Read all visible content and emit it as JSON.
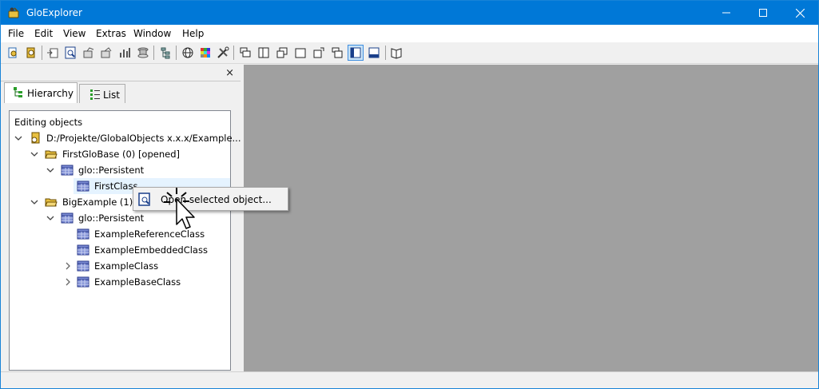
{
  "window": {
    "title": "GloExplorer"
  },
  "menu": [
    "File",
    "Edit",
    "View",
    "Extras",
    "Window",
    "Help"
  ],
  "toolbar": {
    "icons": [
      "open-db-icon",
      "close-db-icon",
      "import-icon",
      "find-icon",
      "copy-icon",
      "paste-icon",
      "chart-icon",
      "spool-icon",
      "tree-icon",
      "globe-icon",
      "grid-colors-icon",
      "tools-icon",
      "window-cascade-icon",
      "window-split-icon",
      "window-restore-icon",
      "window-blank-icon",
      "window-new-icon",
      "window-stack-icon",
      "layout-left-icon",
      "layout-bottom-icon",
      "book-icon"
    ],
    "active": [
      "layout-left-icon"
    ]
  },
  "panel": {
    "close_glyph": "×",
    "tabs": [
      {
        "label": "Hierarchy",
        "active": true
      },
      {
        "label": "List",
        "active": false
      }
    ]
  },
  "tree": {
    "header": "Editing objects",
    "nodes": [
      {
        "label": "D:/Projekte/GlobalObjects x.x.x/Example...",
        "level": 0,
        "icon": "database-icon",
        "expanded": true
      },
      {
        "label": "FirstGloBase (0) [opened]",
        "level": 1,
        "icon": "folder-open-icon",
        "expanded": true
      },
      {
        "label": "glo::Persistent",
        "level": 2,
        "icon": "class-icon",
        "expanded": true
      },
      {
        "label": "FirstClass",
        "level": 3,
        "icon": "class-icon",
        "selected": true
      },
      {
        "label": "BigExample (1) [",
        "level": 1,
        "icon": "folder-open-icon",
        "expanded": true
      },
      {
        "label": "glo::Persistent",
        "level": 2,
        "icon": "class-icon",
        "expanded": true
      },
      {
        "label": "ExampleReferenceClass",
        "level": 3,
        "icon": "class-icon"
      },
      {
        "label": "ExampleEmbeddedClass",
        "level": 3,
        "icon": "class-icon"
      },
      {
        "label": "ExampleClass",
        "level": 3,
        "icon": "class-icon",
        "collapsed": true
      },
      {
        "label": "ExampleBaseClass",
        "level": 3,
        "icon": "class-icon",
        "collapsed": true
      }
    ]
  },
  "context_menu": {
    "item": "Open selected object..."
  },
  "colors": {
    "titlebar": "#0078d7",
    "workspace": "#a0a0a0",
    "selection": "#e5f3ff"
  }
}
